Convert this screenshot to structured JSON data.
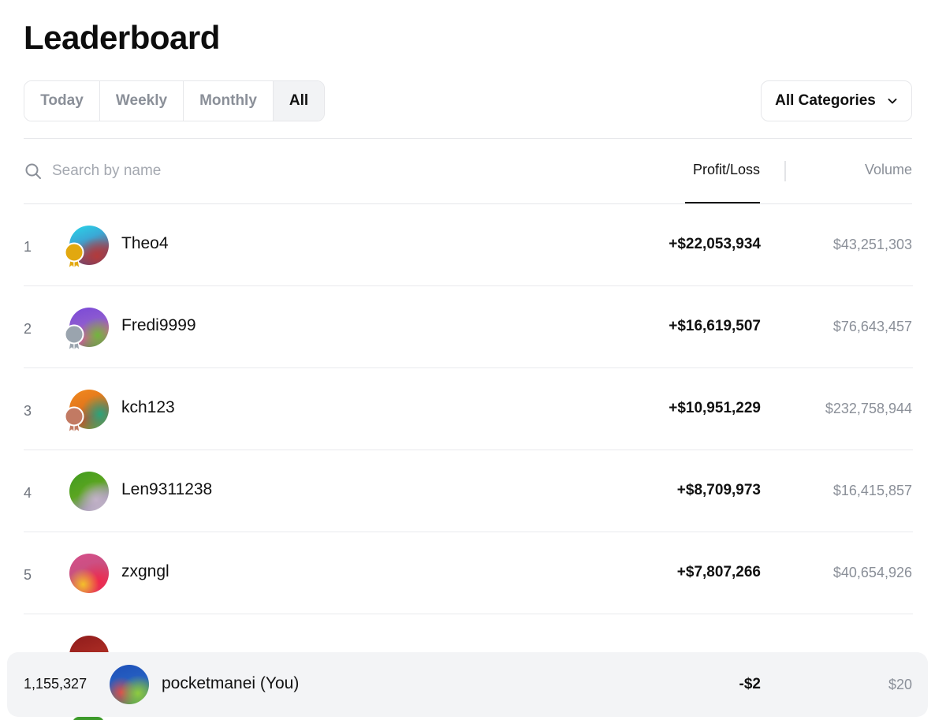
{
  "page": {
    "title": "Leaderboard"
  },
  "filters": {
    "periods": [
      "Today",
      "Weekly",
      "Monthly",
      "All"
    ],
    "active_period": "All",
    "category": {
      "selected": "All Categories",
      "icon": "chevron-down-icon"
    }
  },
  "search": {
    "placeholder": "Search by name",
    "value": "",
    "icon": "search-icon"
  },
  "columns": {
    "profit_loss": "Profit/Loss",
    "volume": "Volume",
    "sort": "Profit/Loss"
  },
  "rows": [
    {
      "rank": "1",
      "name": "Theo4",
      "pnl": "+$22,053,934",
      "volume": "$43,251,303",
      "medal": "gold"
    },
    {
      "rank": "2",
      "name": "Fredi9999",
      "pnl": "+$16,619,507",
      "volume": "$76,643,457",
      "medal": "silver"
    },
    {
      "rank": "3",
      "name": "kch123",
      "pnl": "+$10,951,229",
      "volume": "$232,758,944",
      "medal": "bronze"
    },
    {
      "rank": "4",
      "name": "Len9311238",
      "pnl": "+$8,709,973",
      "volume": "$16,415,857",
      "medal": ""
    },
    {
      "rank": "5",
      "name": "zxgngl",
      "pnl": "+$7,807,266",
      "volume": "$40,654,926",
      "medal": ""
    }
  ],
  "current_user": {
    "rank": "1,155,327",
    "name": "pocketmanei (You)",
    "pnl": "-$2",
    "volume": "$20"
  },
  "colors": {
    "gold": "#E2A80F",
    "silver": "#9AA4AE",
    "bronze": "#C27A63",
    "accent": "#111111",
    "muted": "#8A8F98"
  }
}
